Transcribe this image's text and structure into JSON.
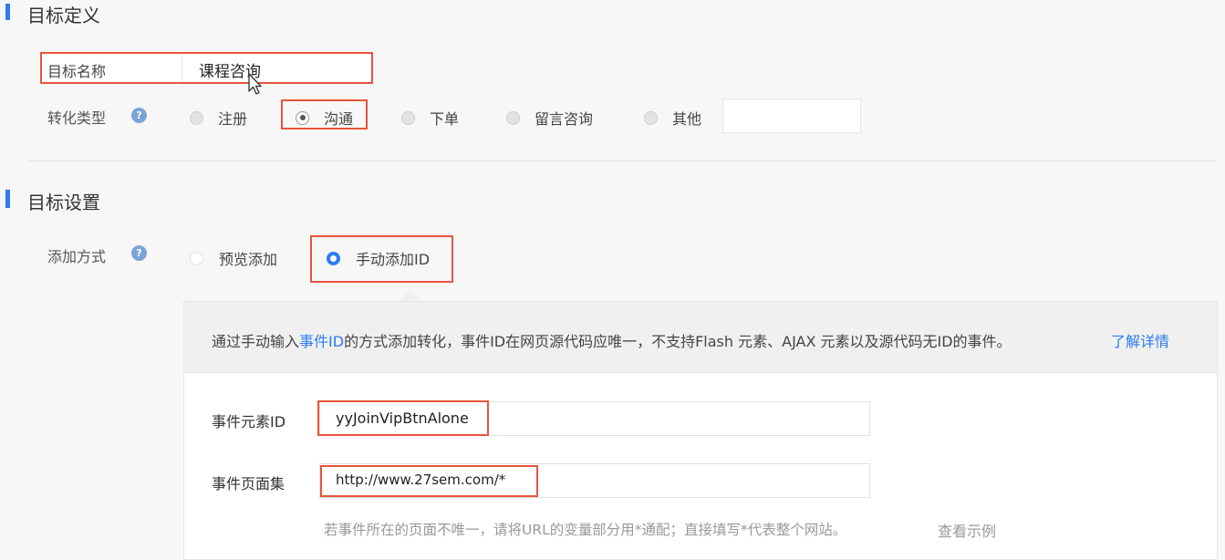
{
  "target_definition": {
    "section_title": "目标定义",
    "name_label": "目标名称",
    "name_value": "课程咨询",
    "conversion_type_label": "转化类型",
    "conversion_options": [
      "注册",
      "沟通",
      "下单",
      "留言咨询",
      "其他"
    ],
    "selected_option": "沟通",
    "other_value": ""
  },
  "target_settings": {
    "section_title": "目标设置",
    "add_method_label": "添加方式",
    "add_methods": [
      "预览添加",
      "手动添加ID"
    ],
    "selected_method": "手动添加ID",
    "info": {
      "prefix": "通过手动输入",
      "link_event_id": "事件ID",
      "suffix": "的方式添加转化，事件ID在网页源代码应唯一，不支持Flash 元素、AJAX 元素以及源代码无ID的事件。",
      "learn_more": "了解详情"
    },
    "event_element_id_label": "事件元素ID",
    "event_element_id_value": "yyJoinVipBtnAlone",
    "event_pages_label": "事件页面集",
    "event_pages_value": "http://www.27sem.com/*",
    "hint_text": "若事件所在的页面不唯一，请将URL的变量部分用*通配；直接填写*代表整个网站。",
    "view_example": "查看示例"
  },
  "colors": {
    "accent": "#2c7cf0",
    "highlight_box": "#e8553b"
  }
}
